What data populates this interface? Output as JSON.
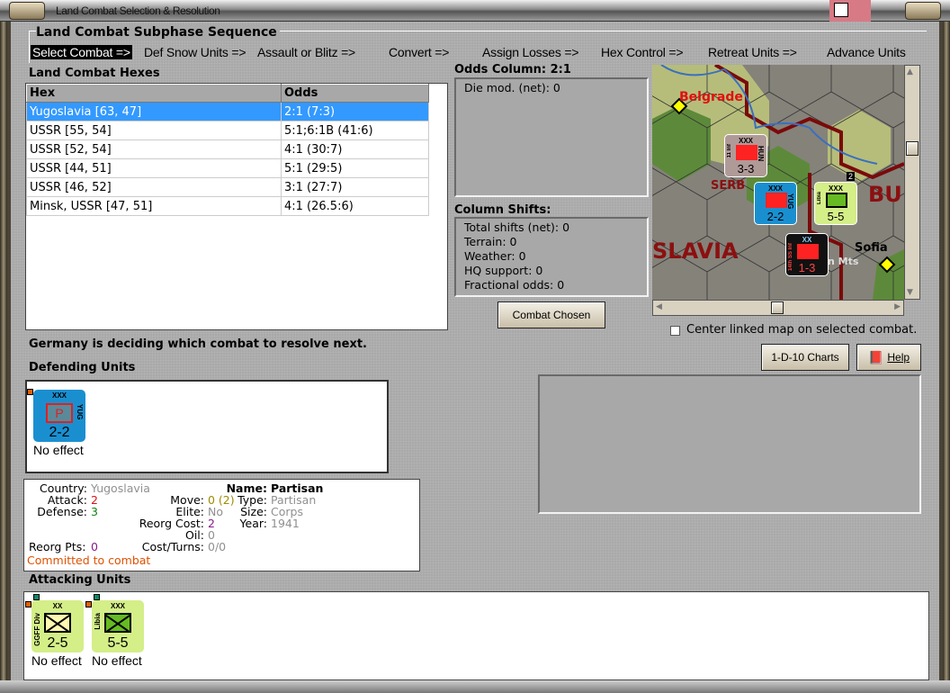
{
  "window": {
    "title": "Land Combat Selection & Resolution"
  },
  "sequence": {
    "title": "Land Combat Subphase Sequence",
    "steps": [
      "Select Combat =>",
      "Def Snow Units =>",
      "Assault or Blitz =>",
      "Convert =>",
      "Assign Losses =>",
      "Hex Control =>",
      "Retreat Units =>",
      "Advance Units"
    ],
    "selected_index": 0
  },
  "hexes": {
    "title": "Land Combat Hexes",
    "columns": [
      "Hex",
      "Odds"
    ],
    "rows": [
      {
        "hex": "Yugoslavia [63, 47]",
        "odds": "2:1 (7:3)"
      },
      {
        "hex": "USSR [55, 54]",
        "odds": "5:1;6:1B (41:6)"
      },
      {
        "hex": "USSR [52, 54]",
        "odds": "4:1 (30:7)"
      },
      {
        "hex": "USSR [44, 51]",
        "odds": "5:1 (29:5)"
      },
      {
        "hex": "USSR [46, 52]",
        "odds": "3:1 (27:7)"
      },
      {
        "hex": "Minsk, USSR [47, 51]",
        "odds": "4:1 (26.5:6)"
      }
    ],
    "selected_index": 0
  },
  "odds": {
    "title": "Odds Column: 2:1",
    "die_mod": "Die mod. (net): 0"
  },
  "shifts": {
    "title": "Column Shifts:",
    "lines": [
      "Total shifts (net): 0",
      "Terrain: 0",
      "Weather: 0",
      "HQ support: 0",
      "Fractional odds: 0"
    ]
  },
  "buttons": {
    "combat_chosen": "Combat Chosen",
    "charts": "1-D-10 Charts",
    "help": "Help"
  },
  "map": {
    "labels": {
      "belgrade": "Belgrade",
      "serbia": "SERB",
      "slavia": "SLAVIA",
      "bu": "BU",
      "sofia": "Sofia",
      "mts": "n Mts"
    },
    "units": [
      {
        "size": "XXX",
        "strength": "3-3",
        "side": "HUN",
        "left": "11 Inf",
        "color": "#b09a98"
      },
      {
        "size": "XXX",
        "strength": "2-2",
        "side": "YUG",
        "color": "#1a8fd0"
      },
      {
        "size": "XXX",
        "strength": "5-5",
        "left": "Libia",
        "color": "#d4ee88",
        "stack": "2"
      },
      {
        "size": "XX",
        "strength": "1-3",
        "left": "14th SS Inf",
        "color": "#111111"
      }
    ]
  },
  "center_map": {
    "label": "Center linked map on selected combat.",
    "checked": false
  },
  "status": "Germany is deciding which combat to resolve next.",
  "defending": {
    "title": "Defending Units",
    "units": [
      {
        "size": "XXX",
        "symbol": "P",
        "side": "YUG",
        "strength": "2-2",
        "effect": "No effect",
        "color": "#1a8fd0"
      }
    ]
  },
  "unit_info": {
    "country_label": "Country:",
    "country": "Yugoslavia",
    "attack_label": "Attack:",
    "attack": "2",
    "defense_label": "Defense:",
    "defense": "3",
    "move_label": "Move:",
    "move": "0 (2)",
    "elite_label": "Elite:",
    "elite": "No",
    "reorg_cost_label": "Reorg Cost:",
    "reorg_cost": "2",
    "oil_label": "Oil:",
    "oil": "0",
    "cost_turns_label": "Cost/Turns:",
    "cost_turns": "0/0",
    "reorg_pts_label": "Reorg Pts:",
    "reorg_pts": "0",
    "name_label": "Name:",
    "name": "Partisan",
    "type_label": "Type:",
    "type": "Partisan",
    "size_label": "Size:",
    "size": "Corps",
    "year_label": "Year:",
    "year": "1941",
    "status": "Committed to combat"
  },
  "attacking": {
    "title": "Attacking Units",
    "units": [
      {
        "size": "XX",
        "side": "GGFF Div",
        "strength": "2-5",
        "effect": "No effect",
        "color": "#d4ee88",
        "fill": "#fff8b0"
      },
      {
        "size": "XXX",
        "side": "Libia",
        "strength": "5-5",
        "effect": "No effect",
        "color": "#d4ee88",
        "fill": "#66bb22"
      }
    ]
  }
}
